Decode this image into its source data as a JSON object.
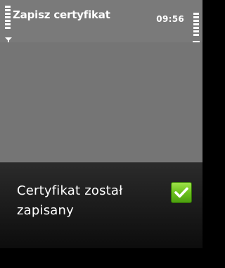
{
  "status_bar": {
    "title": "Zapisz certyfikat",
    "time": "09:56",
    "icons": [
      "signal-strength-icon",
      "antenna-icon",
      "battery-icon"
    ]
  },
  "dialog": {
    "message": "Certyfikat został zapisany",
    "confirm_icon": "checkmark-icon"
  },
  "colors": {
    "status_bg": "#7a7a7a",
    "app_bg": "#757575",
    "dialog_bg": "#1a1a1a",
    "check_green": "#6cc11d"
  }
}
